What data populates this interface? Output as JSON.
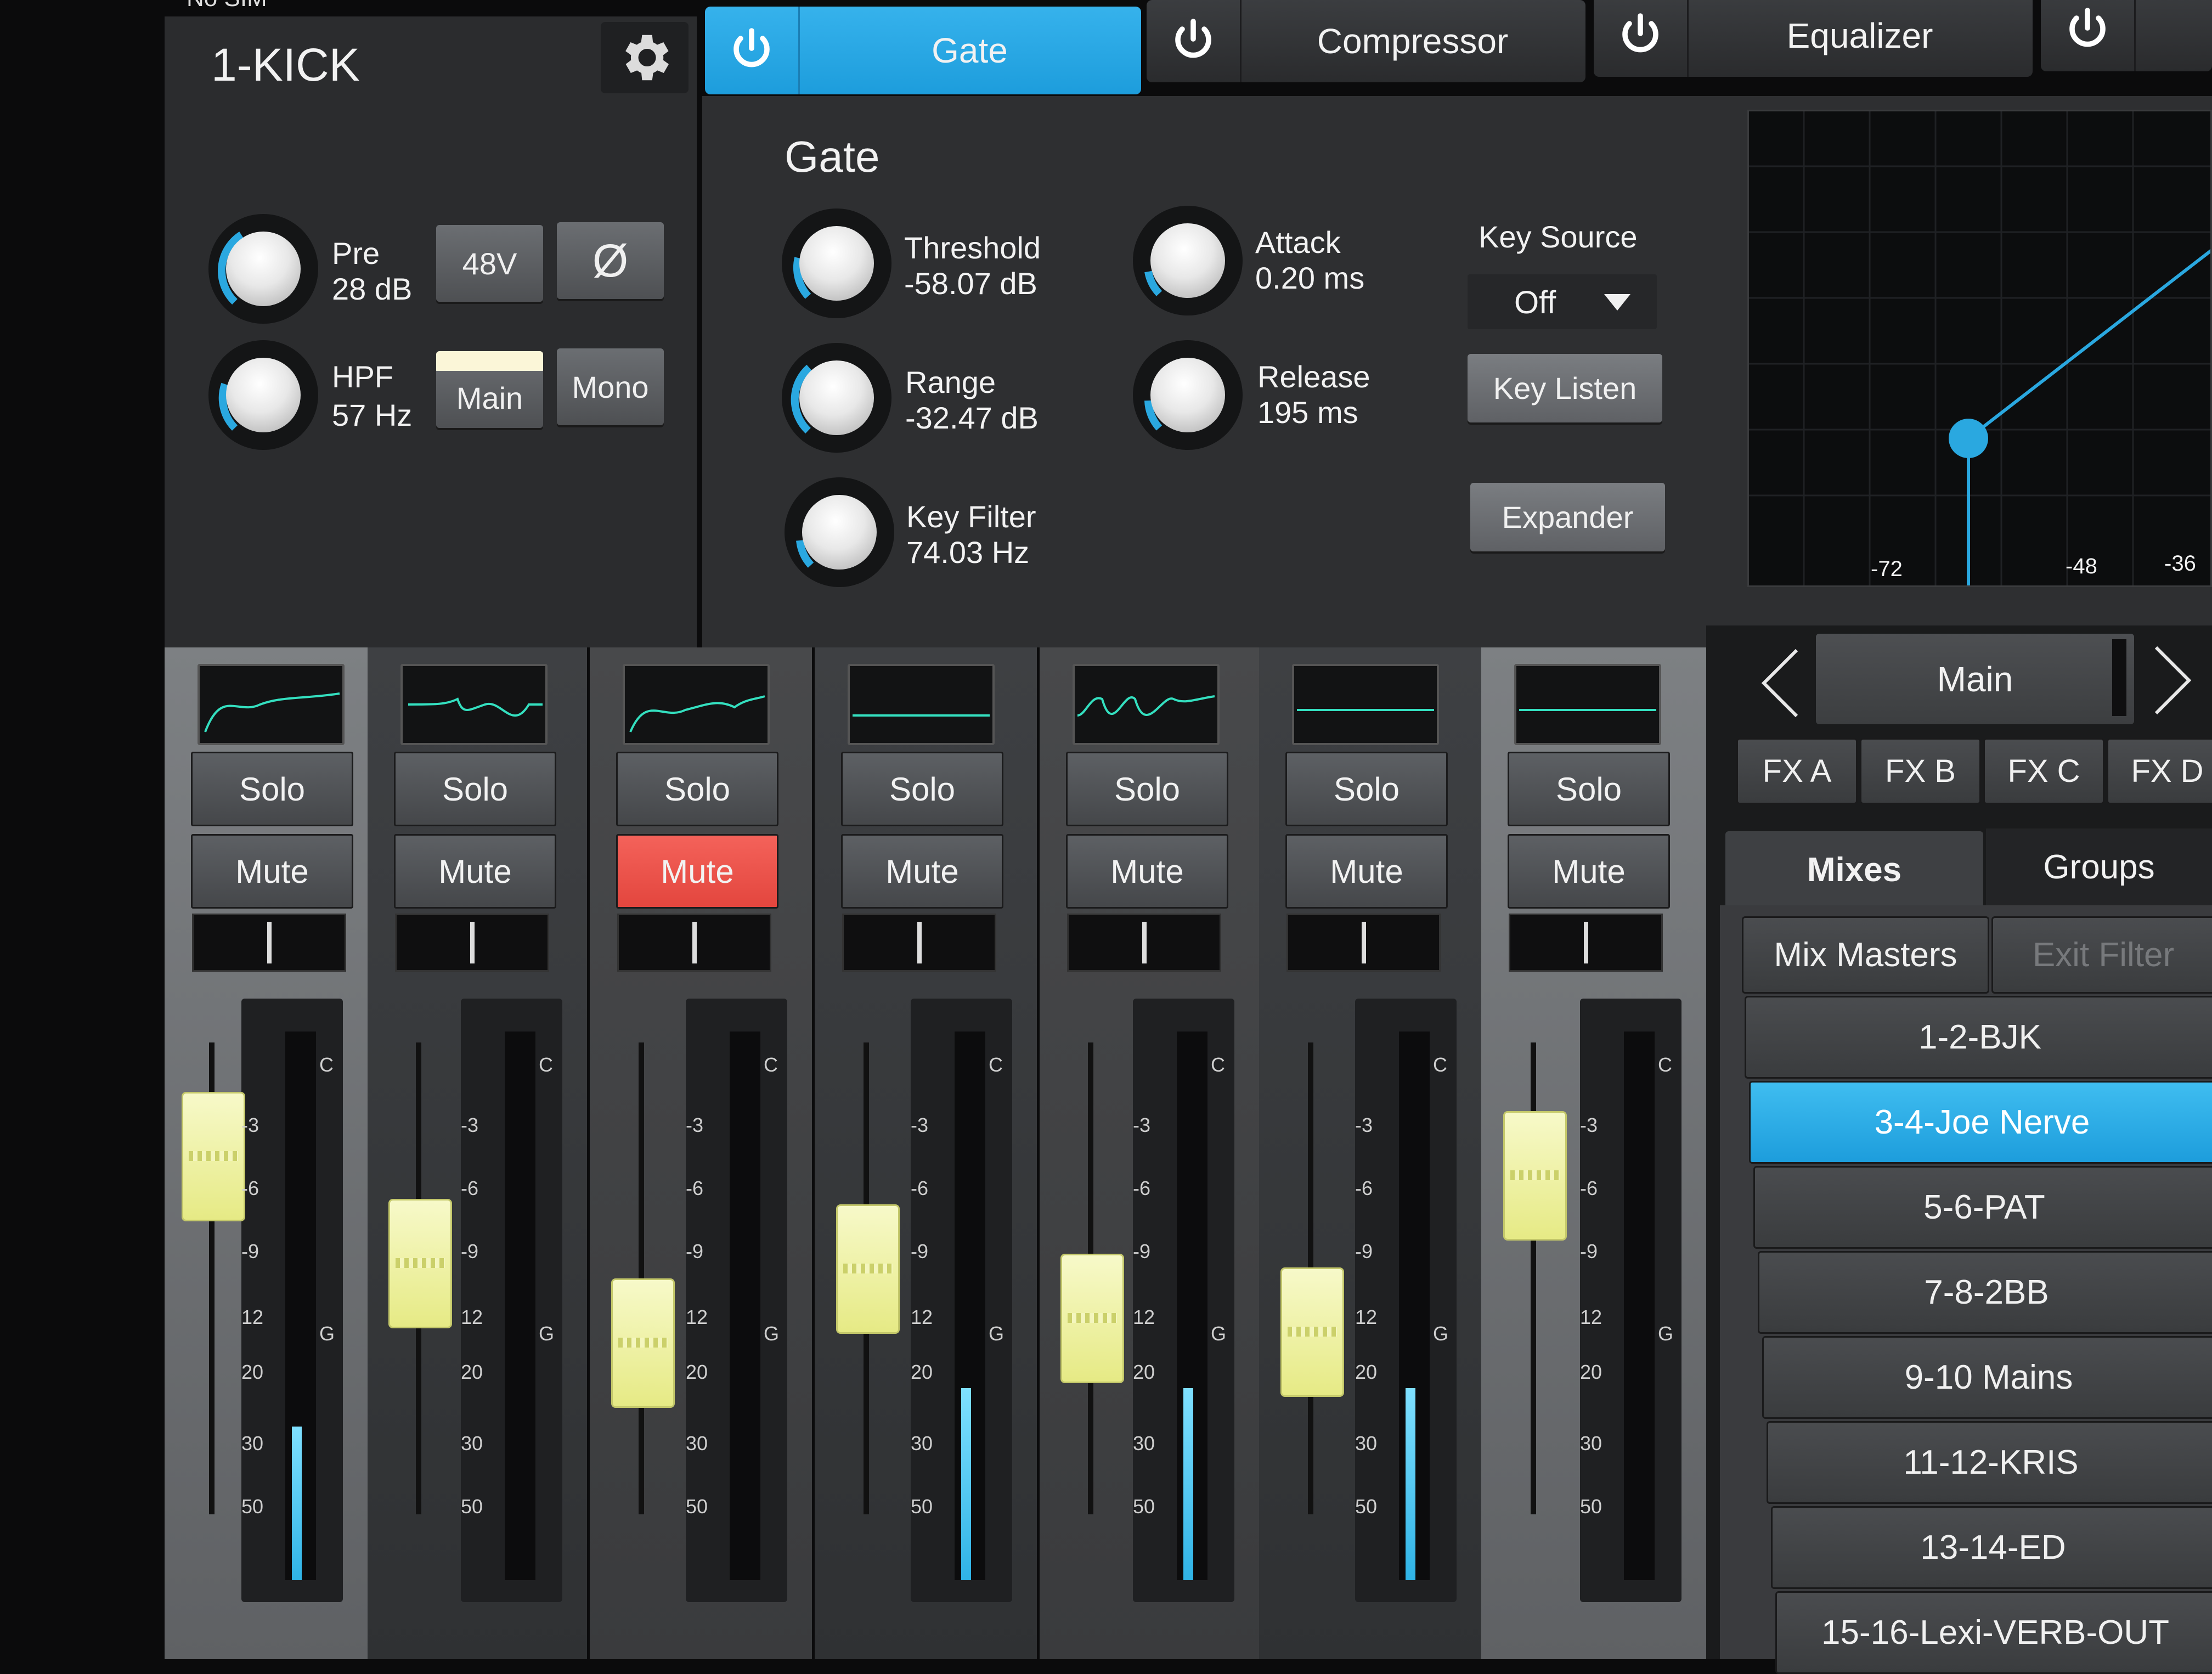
{
  "status_bar": {
    "carrier": "No SIM"
  },
  "channel": {
    "name": "1-KICK"
  },
  "tabs": [
    {
      "label": "Gate",
      "active": true
    },
    {
      "label": "Compressor",
      "active": false
    },
    {
      "label": "Equalizer",
      "active": false
    },
    {
      "label": "",
      "active": false
    }
  ],
  "input": {
    "pre_label": "Pre",
    "pre_value": "28 dB",
    "hpf_label": "HPF",
    "hpf_value": "57 Hz",
    "phantom_label": "48V",
    "phase_label": "Ø",
    "main_label": "Main",
    "mono_label": "Mono"
  },
  "gate": {
    "title": "Gate",
    "threshold_label": "Threshold",
    "threshold_value": "-58.07 dB",
    "range_label": "Range",
    "range_value": "-32.47 dB",
    "keyfilter_label": "Key Filter",
    "keyfilter_value": "74.03 Hz",
    "attack_label": "Attack",
    "attack_value": "0.20 ms",
    "release_label": "Release",
    "release_value": "195 ms",
    "key_source_label": "Key Source",
    "key_source_value": "Off",
    "key_listen_label": "Key Listen",
    "expander_label": "Expander"
  },
  "graph": {
    "ticks": [
      "-72",
      "-48",
      "-36"
    ]
  },
  "strips": [
    {
      "solo": "Solo",
      "mute": "Mute",
      "muted": false,
      "clip": "C",
      "gain": "G"
    },
    {
      "solo": "Solo",
      "mute": "Mute",
      "muted": false,
      "clip": "C",
      "gain": "G"
    },
    {
      "solo": "Solo",
      "mute": "Mute",
      "muted": true,
      "clip": "C",
      "gain": "G"
    },
    {
      "solo": "Solo",
      "mute": "Mute",
      "muted": false,
      "clip": "C",
      "gain": "G"
    },
    {
      "solo": "Solo",
      "mute": "Mute",
      "muted": false,
      "clip": "C",
      "gain": "G"
    },
    {
      "solo": "Solo",
      "mute": "Mute",
      "muted": false,
      "clip": "C",
      "gain": "G"
    },
    {
      "solo": "Solo",
      "mute": "Mute",
      "muted": false,
      "clip": "C",
      "gain": "G"
    }
  ],
  "meter_scale": [
    "-3",
    "-6",
    "-9",
    "12",
    "20",
    "30",
    "50"
  ],
  "mix_selector": {
    "current": "Main",
    "fx": [
      "FX A",
      "FX B",
      "FX C",
      "FX D"
    ]
  },
  "mix_tabs": {
    "mixes": "Mixes",
    "groups": "Groups"
  },
  "mix_filter": {
    "masters": "Mix Masters",
    "exit": "Exit Filter"
  },
  "mix_list": [
    {
      "label": "1-2-BJK",
      "selected": false
    },
    {
      "label": "3-4-Joe Nerve",
      "selected": true
    },
    {
      "label": "5-6-PAT",
      "selected": false
    },
    {
      "label": "7-8-2BB",
      "selected": false
    },
    {
      "label": "9-10 Mains",
      "selected": false
    },
    {
      "label": "11-12-KRIS",
      "selected": false
    },
    {
      "label": "13-14-ED",
      "selected": false
    },
    {
      "label": "15-16-Lexi-VERB-OUT",
      "selected": false
    }
  ],
  "colors": {
    "accent": "#1d9ddc",
    "mute_active": "#e3463e",
    "fader_cap": "#e6ea85",
    "meter": "#2fb3e6"
  }
}
